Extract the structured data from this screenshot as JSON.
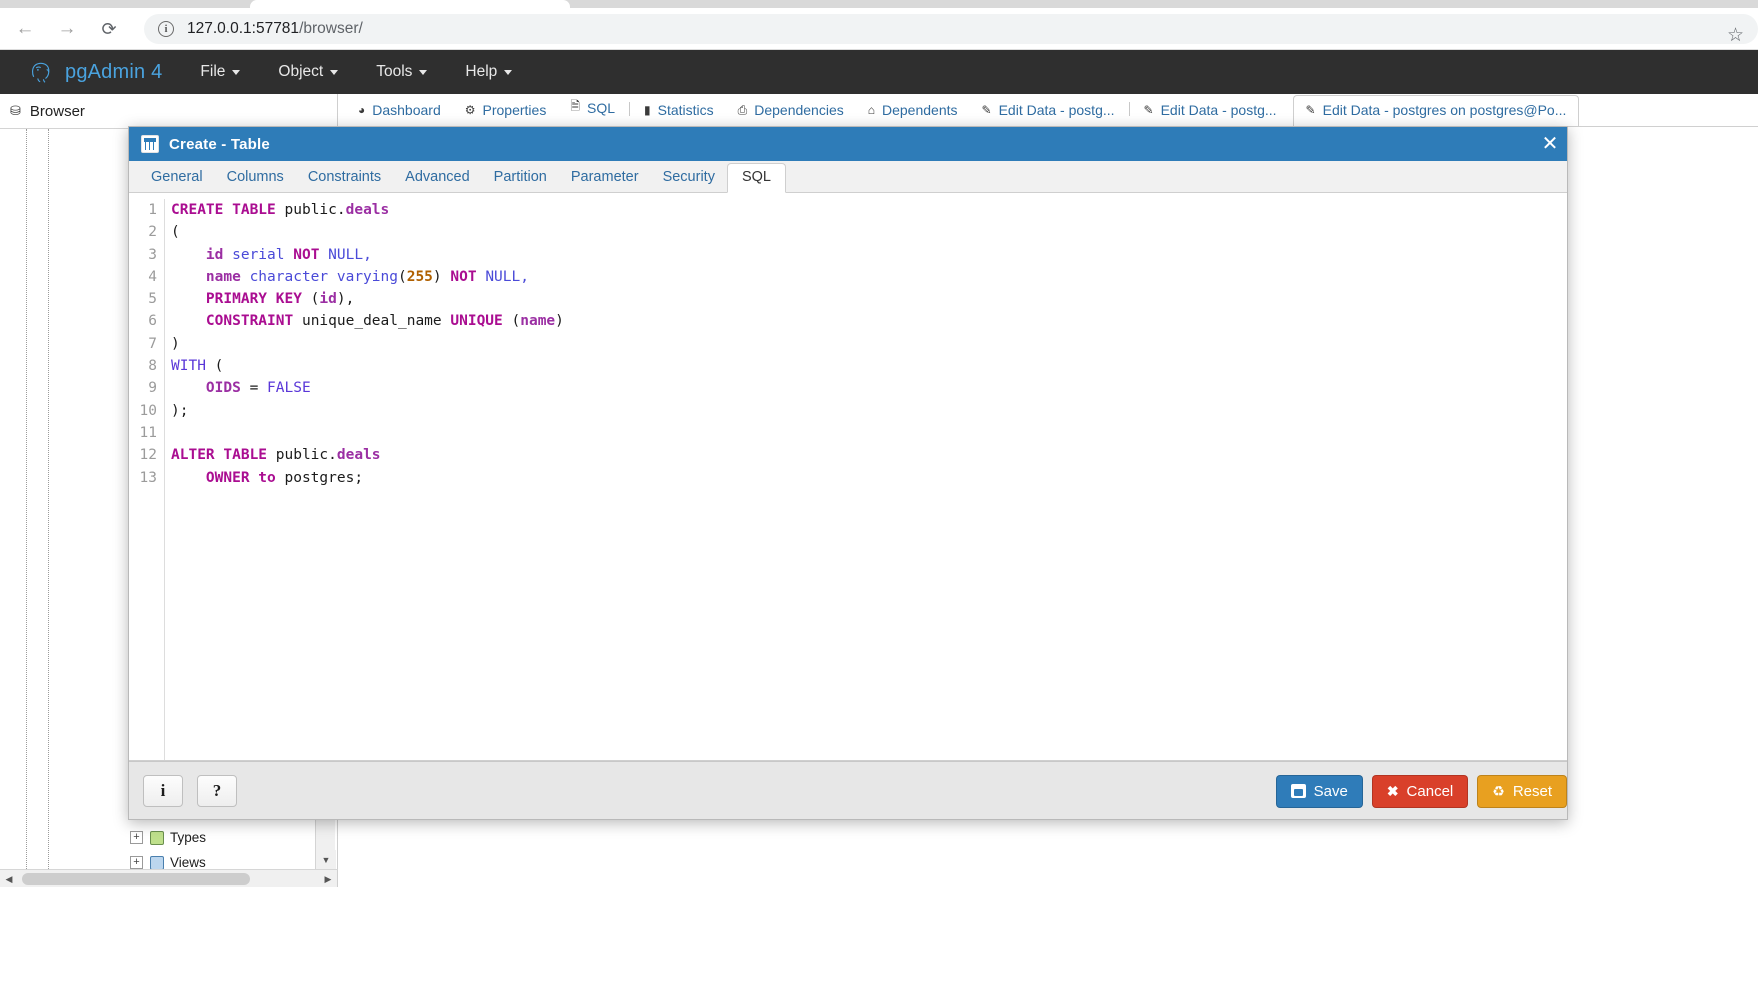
{
  "browser_chrome": {
    "back_icon": "arrow-left-icon",
    "forward_icon": "arrow-right-icon",
    "reload_icon": "reload-icon",
    "site_info_icon": "info-circle-icon",
    "url_host": "127.0.0.1:57781",
    "url_path": "/browser/",
    "bookmark_icon": "star-icon"
  },
  "app": {
    "brand": "pgAdmin 4",
    "logo_icon": "postgres-elephant-icon",
    "menus": [
      {
        "label": "File"
      },
      {
        "label": "Object"
      },
      {
        "label": "Tools"
      },
      {
        "label": "Help"
      }
    ]
  },
  "browser_panel": {
    "header_icon": "browser-tree-icon",
    "header_title": "Browser",
    "tree_items": [
      {
        "label": "Types",
        "icon": "type-icon",
        "expander": "+"
      },
      {
        "label": "Views",
        "icon": "view-icon",
        "expander": "+"
      }
    ],
    "vscroll_up": "▲",
    "vscroll_down": "▼",
    "hscroll_left": "◀",
    "hscroll_right": "▶"
  },
  "object_tabs": [
    {
      "label": "Dashboard",
      "icon": "dashboard-icon"
    },
    {
      "label": "Properties",
      "icon": "properties-icon"
    },
    {
      "label": "SQL",
      "icon": "sql-icon"
    },
    {
      "label": "Statistics",
      "icon": "statistics-icon"
    },
    {
      "label": "Dependencies",
      "icon": "dependencies-icon"
    },
    {
      "label": "Dependents",
      "icon": "dependents-icon"
    },
    {
      "label": "Edit Data - postg...",
      "icon": "edit-data-icon"
    },
    {
      "label": "Edit Data - postg...",
      "icon": "edit-data-icon"
    },
    {
      "label": "Edit Data - postgres on postgres@Po...",
      "icon": "edit-data-icon"
    }
  ],
  "dialog": {
    "title": "Create - Table",
    "title_icon": "table-icon",
    "close_icon": "close-icon",
    "tabs": [
      {
        "label": "General",
        "active": false
      },
      {
        "label": "Columns",
        "active": false
      },
      {
        "label": "Constraints",
        "active": false
      },
      {
        "label": "Advanced",
        "active": false
      },
      {
        "label": "Partition",
        "active": false
      },
      {
        "label": "Parameter",
        "active": false
      },
      {
        "label": "Security",
        "active": false
      },
      {
        "label": "SQL",
        "active": true
      }
    ],
    "sql_lines": [
      {
        "n": "1",
        "tokens": [
          {
            "t": "CREATE TABLE ",
            "c": "kw"
          },
          {
            "t": "public.",
            "c": "plain"
          },
          {
            "t": "deals",
            "c": "ident"
          }
        ]
      },
      {
        "n": "2",
        "tokens": [
          {
            "t": "(",
            "c": "plain"
          }
        ]
      },
      {
        "n": "3",
        "tokens": [
          {
            "t": "    ",
            "c": "plain"
          },
          {
            "t": "id",
            "c": "ident"
          },
          {
            "t": " serial ",
            "c": "typ"
          },
          {
            "t": "NOT",
            "c": "kw"
          },
          {
            "t": " NULL,",
            "c": "typ"
          }
        ]
      },
      {
        "n": "4",
        "tokens": [
          {
            "t": "    ",
            "c": "plain"
          },
          {
            "t": "name",
            "c": "ident"
          },
          {
            "t": " character varying",
            "c": "typ"
          },
          {
            "t": "(",
            "c": "plain"
          },
          {
            "t": "255",
            "c": "num"
          },
          {
            "t": ") ",
            "c": "plain"
          },
          {
            "t": "NOT",
            "c": "kw"
          },
          {
            "t": " NULL,",
            "c": "typ"
          }
        ]
      },
      {
        "n": "5",
        "tokens": [
          {
            "t": "    ",
            "c": "plain"
          },
          {
            "t": "PRIMARY KEY",
            "c": "kw"
          },
          {
            "t": " (",
            "c": "plain"
          },
          {
            "t": "id",
            "c": "ident"
          },
          {
            "t": "),",
            "c": "plain"
          }
        ]
      },
      {
        "n": "6",
        "tokens": [
          {
            "t": "    ",
            "c": "plain"
          },
          {
            "t": "CONSTRAINT",
            "c": "kw"
          },
          {
            "t": " unique_deal_name ",
            "c": "plain"
          },
          {
            "t": "UNIQUE",
            "c": "kw"
          },
          {
            "t": " (",
            "c": "plain"
          },
          {
            "t": "name",
            "c": "ident"
          },
          {
            "t": ")",
            "c": "plain"
          }
        ]
      },
      {
        "n": "7",
        "tokens": [
          {
            "t": ")",
            "c": "plain"
          }
        ]
      },
      {
        "n": "8",
        "tokens": [
          {
            "t": "WITH",
            "c": "kw2"
          },
          {
            "t": " (",
            "c": "plain"
          }
        ]
      },
      {
        "n": "9",
        "tokens": [
          {
            "t": "    ",
            "c": "plain"
          },
          {
            "t": "OIDS",
            "c": "ident"
          },
          {
            "t": " = ",
            "c": "plain"
          },
          {
            "t": "FALSE",
            "c": "kw2"
          }
        ]
      },
      {
        "n": "10",
        "tokens": [
          {
            "t": ");",
            "c": "plain"
          }
        ]
      },
      {
        "n": "11",
        "tokens": [
          {
            "t": "",
            "c": "plain"
          }
        ]
      },
      {
        "n": "12",
        "tokens": [
          {
            "t": "ALTER TABLE ",
            "c": "kw"
          },
          {
            "t": "public.",
            "c": "plain"
          },
          {
            "t": "deals",
            "c": "ident"
          }
        ]
      },
      {
        "n": "13",
        "tokens": [
          {
            "t": "    ",
            "c": "plain"
          },
          {
            "t": "OWNER to",
            "c": "kw"
          },
          {
            "t": " postgres;",
            "c": "plain"
          }
        ]
      }
    ],
    "footer": {
      "info_label": "i",
      "help_label": "?",
      "save_label": "Save",
      "save_icon": "save-disk-icon",
      "cancel_label": "Cancel",
      "cancel_icon": "cancel-x-icon",
      "reset_label": "Reset",
      "reset_icon": "reset-icon"
    }
  },
  "colors": {
    "dialog_header": "#2e7cb8",
    "save": "#2f7cb9",
    "cancel": "#d9402a",
    "reset": "#e8a020",
    "brand": "#4aa3df",
    "nav_bg": "#2f2f2f"
  }
}
